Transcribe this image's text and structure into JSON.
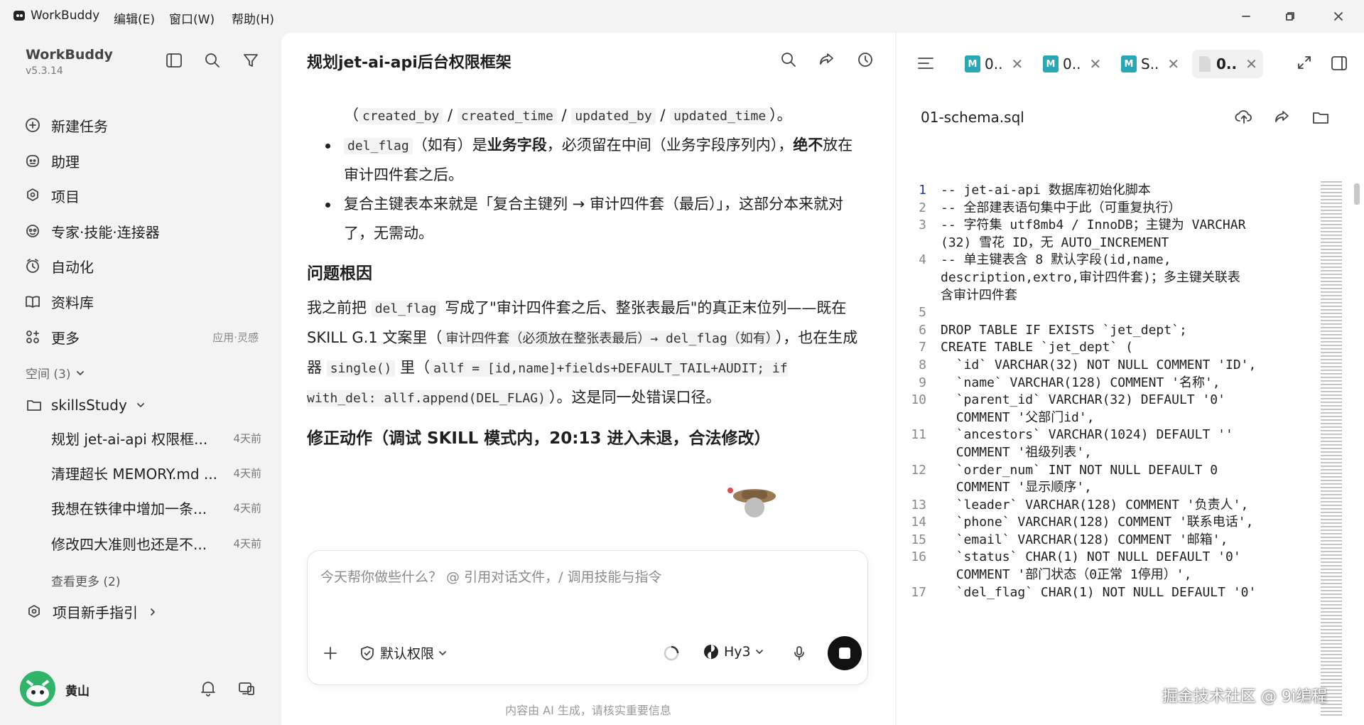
{
  "window": {
    "app_name": "WorkBuddy",
    "menu": [
      "编辑(E)",
      "窗口(W)",
      "帮助(H)"
    ]
  },
  "sidebar": {
    "app_title": "WorkBuddy",
    "version": "v5.3.14",
    "nav": [
      {
        "label": "新建任务",
        "icon": "plus-chat-icon"
      },
      {
        "label": "助理",
        "icon": "assistant-icon"
      },
      {
        "label": "项目",
        "icon": "project-icon"
      },
      {
        "label": "专家·技能·连接器",
        "icon": "experts-icon"
      },
      {
        "label": "自动化",
        "icon": "automation-icon"
      },
      {
        "label": "资料库",
        "icon": "library-icon"
      },
      {
        "label": "更多",
        "icon": "more-apps-icon",
        "hint": "应用·灵感"
      }
    ],
    "space_section": "空间 (3)",
    "workspace": "skillsStudy",
    "threads": [
      {
        "title": "规划 jet-ai-api 权限框...",
        "date": "4天前"
      },
      {
        "title": "清理超长 MEMORY.md ...",
        "date": "4天前"
      },
      {
        "title": "我想在铁律中增加一条...",
        "date": "4天前"
      },
      {
        "title": "修改四大准则也还是不...",
        "date": "4天前"
      }
    ],
    "see_more": "查看更多 (2)",
    "guide": "项目新手指引",
    "user_name": "黄山"
  },
  "chat": {
    "title": "规划jet-ai-api后台权限框架",
    "input_placeholder": "今天帮你做些什么？ @ 引用对话文件，/ 调用技能与指令",
    "permission_label": "默认权限",
    "model_label": "Hy3",
    "footer_note": "内容由 AI 生成，请核实重要信息"
  },
  "doc": {
    "line0_open": "（",
    "line0_codes": [
      "created_by",
      "created_time",
      "updated_by",
      "updated_time"
    ],
    "line0_sep": " / ",
    "line0_close": "）。",
    "b1_code": "del_flag",
    "b1_a": "（如有）是",
    "b1_b": "业务字段",
    "b1_c": "，必须留在中间（业务字段序列内），",
    "b1_d": "绝不",
    "b1_e": "放在审计四件套之后。",
    "b2": "复合主键表本来就是「复合主键列 → 审计四件套（最后）」，这部分本来就对了，无需动。",
    "h_root": "问题根因",
    "p1_a": "我之前把 ",
    "p1_code1": "del_flag",
    "p1_b": " 写成了\"审计四件套之后、整张表最后\"的真正末位列——既在 SKILL G.1 文案里（",
    "p1_code2": "审计四件套（必须放在整张表最后）→ del_flag（如有）",
    "p1_c": "），也在生成器 ",
    "p1_code3": "single()",
    "p1_d": " 里（",
    "p1_code4": "allf = [id,name]+fields+DEFAULT_TAIL+AUDIT; if with_del: allf.append(DEL_FLAG)",
    "p1_e": "）。这是同一处错误口径。",
    "h_fix": "修正动作（调试 SKILL 模式内，20:13 进入未退，合法修改）"
  },
  "right_panel": {
    "tabs": [
      {
        "label": "0..",
        "icon": "markdown-file-icon"
      },
      {
        "label": "0..",
        "icon": "markdown-file-icon"
      },
      {
        "label": "S..",
        "icon": "markdown-file-icon"
      },
      {
        "label": "0..",
        "icon": "file-icon"
      }
    ],
    "filename": "01-schema.sql",
    "code": [
      {
        "n": "1",
        "t": "-- jet-ai-api 数据库初始化脚本"
      },
      {
        "n": "2",
        "t": "-- 全部建表语句集中于此（可重复执行）"
      },
      {
        "n": "3",
        "t": "-- 字符集 utf8mb4 / InnoDB；主键为 VARCHAR\n(32) 雪花 ID，无 AUTO_INCREMENT"
      },
      {
        "n": "4",
        "t": "-- 单主键表含 8 默认字段(id,name,\ndescription,extro,审计四件套)；多主键关联表\n含审计四件套"
      },
      {
        "n": "5",
        "t": ""
      },
      {
        "n": "6",
        "t": "DROP TABLE IF EXISTS `jet_dept`;"
      },
      {
        "n": "7",
        "t": "CREATE TABLE `jet_dept` ("
      },
      {
        "n": "8",
        "t": "  `id` VARCHAR(32) NOT NULL COMMENT 'ID',"
      },
      {
        "n": "9",
        "t": "  `name` VARCHAR(128) COMMENT '名称',"
      },
      {
        "n": "10",
        "t": "  `parent_id` VARCHAR(32) DEFAULT '0'\n  COMMENT '父部门id',"
      },
      {
        "n": "11",
        "t": "  `ancestors` VARCHAR(1024) DEFAULT ''\n  COMMENT '祖级列表',"
      },
      {
        "n": "12",
        "t": "  `order_num` INT NOT NULL DEFAULT 0\n  COMMENT '显示顺序',"
      },
      {
        "n": "13",
        "t": "  `leader` VARCHAR(128) COMMENT '负责人',"
      },
      {
        "n": "14",
        "t": "  `phone` VARCHAR(128) COMMENT '联系电话',"
      },
      {
        "n": "15",
        "t": "  `email` VARCHAR(128) COMMENT '邮箱',"
      },
      {
        "n": "16",
        "t": "  `status` CHAR(1) NOT NULL DEFAULT '0'\n  COMMENT '部门状态（0正常 1停用）',"
      },
      {
        "n": "17",
        "t": "  `del_flag` CHAR(1) NOT NULL DEFAULT '0'"
      }
    ]
  },
  "watermark": "掘金技术社区 @ 9i编程"
}
